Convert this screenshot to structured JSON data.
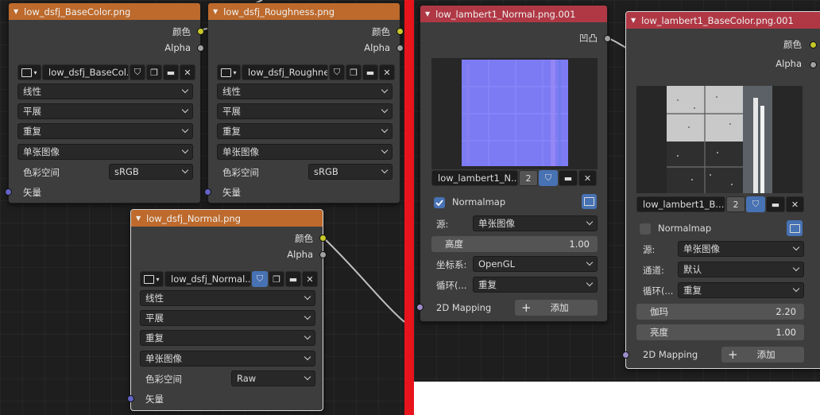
{
  "left_nodes": {
    "basecolor": {
      "title": "low_dsfj_BaseColor.png",
      "outputs": {
        "color": "颜色",
        "alpha": "Alpha"
      },
      "image_name": "low_dsfj_BaseCol...",
      "interpolation": "线性",
      "projection": "平展",
      "extension": "重复",
      "source": "单张图像",
      "colorspace_label": "色彩空间",
      "colorspace": "sRGB",
      "input_vector": "矢量"
    },
    "roughness": {
      "title": "low_dsfj_Roughness.png",
      "outputs": {
        "color": "颜色",
        "alpha": "Alpha"
      },
      "image_name": "low_dsfj_Roughne...",
      "interpolation": "线性",
      "projection": "平展",
      "extension": "重复",
      "source": "单张图像",
      "colorspace_label": "色彩空间",
      "colorspace": "sRGB",
      "input_vector": "矢量"
    },
    "normal": {
      "title": "low_dsfj_Normal.png",
      "outputs": {
        "color": "颜色",
        "alpha": "Alpha"
      },
      "image_name": "low_dsfj_Normal....",
      "interpolation": "线性",
      "projection": "平展",
      "extension": "重复",
      "source": "单张图像",
      "colorspace_label": "色彩空间",
      "colorspace": "Raw",
      "input_vector": "矢量"
    }
  },
  "right_nodes": {
    "normal": {
      "title": "low_lambert1_Normal.png.001",
      "output_bump": "凹凸",
      "image_name": "low_lambert1_N...",
      "users": "2",
      "normalmap_label": "Normalmap",
      "normalmap_checked": true,
      "source_label": "源:",
      "source": "单张图像",
      "height_label": "高度",
      "height_value": "1.00",
      "coord_label": "坐标系:",
      "coord": "OpenGL",
      "loop_label": "循环(...",
      "loop": "重复",
      "mapping_label": "2D Mapping",
      "add_label": "添加"
    },
    "basecolor": {
      "title": "low_lambert1_BaseColor.png.001",
      "outputs": {
        "color": "颜色",
        "alpha": "Alpha"
      },
      "image_name": "low_lambert1_B...",
      "users": "2",
      "normalmap_label": "Normalmap",
      "normalmap_checked": false,
      "source_label": "源:",
      "source": "单张图像",
      "channel_label": "通道:",
      "channel": "默认",
      "loop_label": "循环(...",
      "loop": "重复",
      "gamma_label": "伽玛",
      "gamma_value": "2.20",
      "brightness_label": "亮度",
      "brightness_value": "1.00",
      "mapping_label": "2D Mapping",
      "add_label": "添加"
    }
  },
  "colors": {
    "texture_header": "#bd6a2c",
    "normal_header": "#b03845",
    "divider": "#e8141b",
    "accent": "#4772b3",
    "socket_color": "#c7c729",
    "socket_vector": "#6363c7"
  }
}
